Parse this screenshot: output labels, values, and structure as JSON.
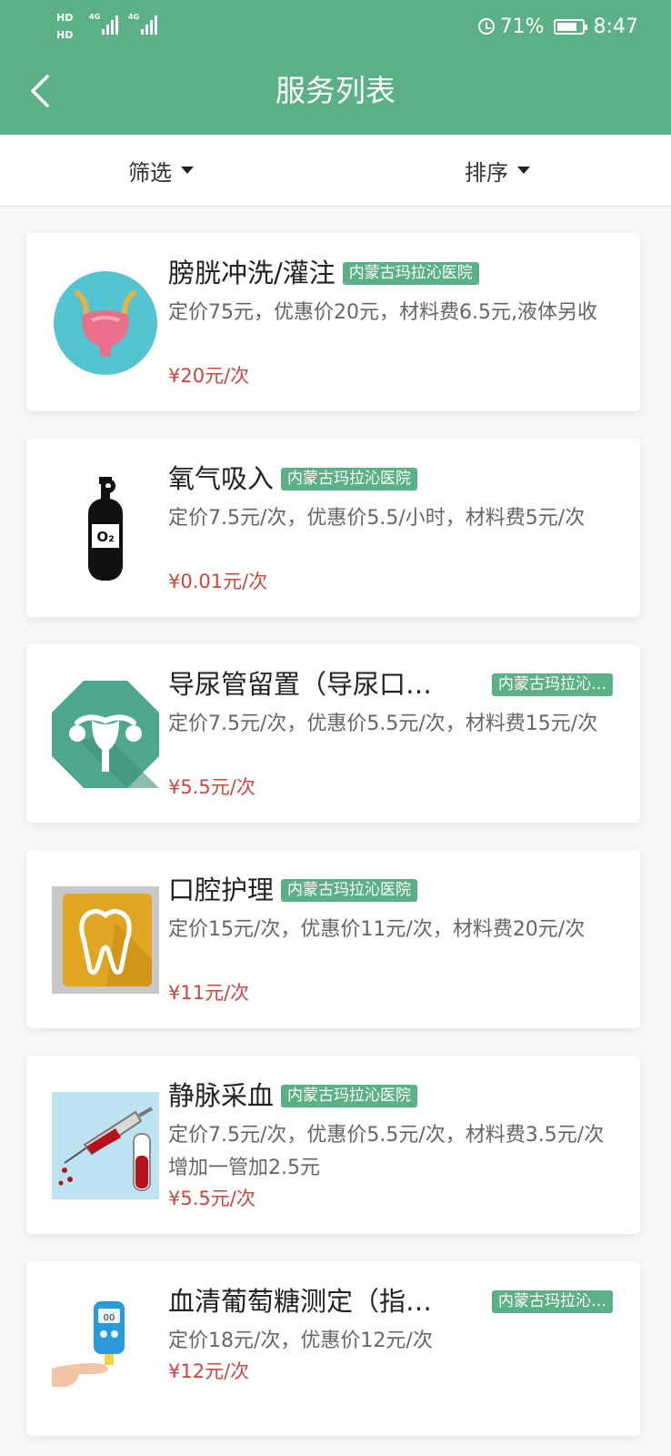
{
  "status_bar": {
    "net1": "HD",
    "net2": "HD",
    "sig1": "4G",
    "sig2": "4G",
    "battery": "71%",
    "time": "8:47"
  },
  "header": {
    "title": "服务列表"
  },
  "filters": {
    "filter_label": "筛选",
    "sort_label": "排序"
  },
  "services": [
    {
      "name": "膀胱冲洗/灌注",
      "hospital": "内蒙古玛拉沁医院",
      "desc": "定价75元，优惠价20元，材料费6.5元,液体另收",
      "price": "¥20元/次",
      "icon": "bladder-icon"
    },
    {
      "name": "氧气吸入",
      "hospital": "内蒙古玛拉沁医院",
      "desc": "定价7.5元/次，优惠价5.5/小时，材料费5元/次",
      "price": "¥0.01元/次",
      "icon": "oxygen-tank-icon"
    },
    {
      "name": "导尿管留置（导尿口…",
      "hospital": "内蒙古玛拉沁…",
      "desc": "定价7.5元/次，优惠价5.5元/次，材料费15元/次",
      "price": "¥5.5元/次",
      "icon": "uterus-icon"
    },
    {
      "name": "口腔护理",
      "hospital": "内蒙古玛拉沁医院",
      "desc": "定价15元/次，优惠价11元/次，材料费20元/次",
      "price": "¥11元/次",
      "icon": "tooth-icon"
    },
    {
      "name": "静脉采血",
      "hospital": "内蒙古玛拉沁医院",
      "desc": "定价7.5元/次，优惠价5.5元/次，材料费3.5元/次 增加一管加2.5元",
      "price": "¥5.5元/次",
      "icon": "syringe-icon"
    },
    {
      "name": "血清葡萄糖测定（指…",
      "hospital": "内蒙古玛拉沁…",
      "desc": "定价18元/次，优惠价12元/次",
      "price": "¥12元/次",
      "icon": "glucose-meter-icon"
    }
  ],
  "colors": {
    "primary": "#5bb185",
    "price": "#c9463d"
  }
}
